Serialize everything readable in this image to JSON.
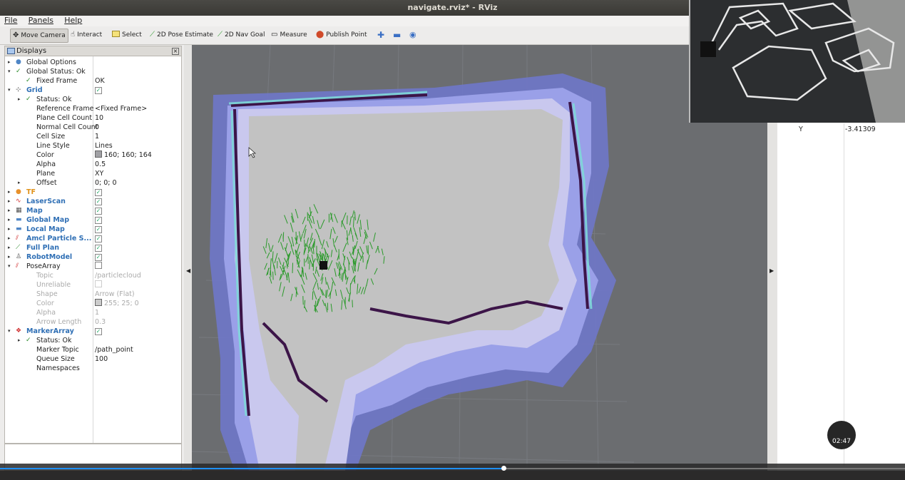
{
  "window": {
    "title": "navigate.rviz* - RViz"
  },
  "menu": [
    "File",
    "Panels",
    "Help"
  ],
  "toolbar": {
    "move_camera": "Move Camera",
    "interact": "Interact",
    "select": "Select",
    "pose_estimate": "2D Pose Estimate",
    "nav_goal": "2D Nav Goal",
    "measure": "Measure",
    "publish_point": "Publish Point"
  },
  "displays_panel": {
    "title": "Displays"
  },
  "tree": [
    {
      "name": "Global Options",
      "value": "",
      "indent": 0,
      "arrow": "▸",
      "icon": "globe-icon",
      "glyph": "●",
      "iconColor": "#4f86c6",
      "style": "",
      "check": ""
    },
    {
      "name": "Global Status: Ok",
      "value": "",
      "indent": 0,
      "arrow": "▾",
      "icon": "check-icon",
      "glyph": "✓",
      "iconColor": "#2a8a2a",
      "style": "",
      "check": ""
    },
    {
      "name": "Fixed Frame",
      "value": "OK",
      "indent": 1,
      "arrow": "",
      "icon": "check-icon",
      "glyph": "✓",
      "iconColor": "#2a8a2a",
      "style": "",
      "check": ""
    },
    {
      "name": "Grid",
      "value": "",
      "indent": 0,
      "arrow": "▾",
      "icon": "grid-icon",
      "glyph": "⊹",
      "iconColor": "#555",
      "style": "blue",
      "check": "on"
    },
    {
      "name": "Status: Ok",
      "value": "",
      "indent": 1,
      "arrow": "▸",
      "icon": "check-icon",
      "glyph": "✓",
      "iconColor": "#2a8a2a",
      "style": "",
      "check": ""
    },
    {
      "name": "Reference Frame",
      "value": "<Fixed Frame>",
      "indent": 1,
      "arrow": "",
      "icon": "",
      "glyph": "",
      "iconColor": "",
      "style": "",
      "check": ""
    },
    {
      "name": "Plane Cell Count",
      "value": "10",
      "indent": 1,
      "arrow": "",
      "icon": "",
      "glyph": "",
      "iconColor": "",
      "style": "",
      "check": ""
    },
    {
      "name": "Normal Cell Count",
      "value": "0",
      "indent": 1,
      "arrow": "",
      "icon": "",
      "glyph": "",
      "iconColor": "",
      "style": "",
      "check": ""
    },
    {
      "name": "Cell Size",
      "value": "1",
      "indent": 1,
      "arrow": "",
      "icon": "",
      "glyph": "",
      "iconColor": "",
      "style": "",
      "check": ""
    },
    {
      "name": "Line Style",
      "value": "Lines",
      "indent": 1,
      "arrow": "",
      "icon": "",
      "glyph": "",
      "iconColor": "",
      "style": "",
      "check": ""
    },
    {
      "name": "Color",
      "value": "160; 160; 164",
      "indent": 1,
      "arrow": "",
      "icon": "",
      "glyph": "",
      "iconColor": "",
      "style": "",
      "check": "",
      "swatch": "#a0a0a4"
    },
    {
      "name": "Alpha",
      "value": "0.5",
      "indent": 1,
      "arrow": "",
      "icon": "",
      "glyph": "",
      "iconColor": "",
      "style": "",
      "check": ""
    },
    {
      "name": "Plane",
      "value": "XY",
      "indent": 1,
      "arrow": "",
      "icon": "",
      "glyph": "",
      "iconColor": "",
      "style": "",
      "check": ""
    },
    {
      "name": "Offset",
      "value": "0; 0; 0",
      "indent": 1,
      "arrow": "▸",
      "icon": "",
      "glyph": "",
      "iconColor": "",
      "style": "",
      "check": ""
    },
    {
      "name": "TF",
      "value": "",
      "indent": 0,
      "arrow": "▸",
      "icon": "tf-icon",
      "glyph": "●",
      "iconColor": "#e8912b",
      "style": "orange",
      "check": "on"
    },
    {
      "name": "LaserScan",
      "value": "",
      "indent": 0,
      "arrow": "▸",
      "icon": "laser-icon",
      "glyph": "∿",
      "iconColor": "#d03030",
      "style": "blue",
      "check": "on"
    },
    {
      "name": "Map",
      "value": "",
      "indent": 0,
      "arrow": "▸",
      "icon": "map-icon",
      "glyph": "▦",
      "iconColor": "#555",
      "style": "blue",
      "check": "on"
    },
    {
      "name": "Global Map",
      "value": "",
      "indent": 0,
      "arrow": "▸",
      "icon": "folder-icon",
      "glyph": "▬",
      "iconColor": "#4f86c6",
      "style": "blue",
      "check": "on"
    },
    {
      "name": "Local Map",
      "value": "",
      "indent": 0,
      "arrow": "▸",
      "icon": "folder-icon",
      "glyph": "▬",
      "iconColor": "#4f86c6",
      "style": "blue",
      "check": "on"
    },
    {
      "name": "Amcl Particle S...",
      "value": "",
      "indent": 0,
      "arrow": "▸",
      "icon": "pose-array-icon",
      "glyph": "⫽",
      "iconColor": "#d03030",
      "style": "blue",
      "check": "on"
    },
    {
      "name": "Full Plan",
      "value": "",
      "indent": 0,
      "arrow": "▸",
      "icon": "path-icon",
      "glyph": "⟋",
      "iconColor": "#2a8a2a",
      "style": "blue",
      "check": "on"
    },
    {
      "name": "RobotModel",
      "value": "",
      "indent": 0,
      "arrow": "▸",
      "icon": "robot-icon",
      "glyph": "♙",
      "iconColor": "#555",
      "style": "blue",
      "check": "on"
    },
    {
      "name": "PoseArray",
      "value": "",
      "indent": 0,
      "arrow": "▾",
      "icon": "pose-array-icon",
      "glyph": "⫽",
      "iconColor": "#d03030",
      "style": "",
      "check": "off"
    },
    {
      "name": "Topic",
      "value": "/particlecloud",
      "indent": 1,
      "arrow": "",
      "icon": "",
      "glyph": "",
      "iconColor": "",
      "style": "grey",
      "check": ""
    },
    {
      "name": "Unreliable",
      "value": "",
      "indent": 1,
      "arrow": "",
      "icon": "",
      "glyph": "",
      "iconColor": "",
      "style": "grey",
      "check": "dim"
    },
    {
      "name": "Shape",
      "value": "Arrow (Flat)",
      "indent": 1,
      "arrow": "",
      "icon": "",
      "glyph": "",
      "iconColor": "",
      "style": "grey",
      "check": ""
    },
    {
      "name": "Color",
      "value": "255; 25; 0",
      "indent": 1,
      "arrow": "",
      "icon": "",
      "glyph": "",
      "iconColor": "",
      "style": "grey",
      "check": "",
      "swatch": "#cccccc"
    },
    {
      "name": "Alpha",
      "value": "1",
      "indent": 1,
      "arrow": "",
      "icon": "",
      "glyph": "",
      "iconColor": "",
      "style": "grey",
      "check": ""
    },
    {
      "name": "Arrow Length",
      "value": "0.3",
      "indent": 1,
      "arrow": "",
      "icon": "",
      "glyph": "",
      "iconColor": "",
      "style": "grey",
      "check": ""
    },
    {
      "name": "MarkerArray",
      "value": "",
      "indent": 0,
      "arrow": "▾",
      "icon": "marker-icon",
      "glyph": "❖",
      "iconColor": "#d03030",
      "style": "blue",
      "check": "on"
    },
    {
      "name": "Status: Ok",
      "value": "",
      "indent": 1,
      "arrow": "▸",
      "icon": "check-icon",
      "glyph": "✓",
      "iconColor": "#2a8a2a",
      "style": "",
      "check": ""
    },
    {
      "name": "Marker Topic",
      "value": "/path_point",
      "indent": 1,
      "arrow": "",
      "icon": "",
      "glyph": "",
      "iconColor": "",
      "style": "",
      "check": ""
    },
    {
      "name": "Queue Size",
      "value": "100",
      "indent": 1,
      "arrow": "",
      "icon": "",
      "glyph": "",
      "iconColor": "",
      "style": "",
      "check": ""
    },
    {
      "name": "Namespaces",
      "value": "",
      "indent": 1,
      "arrow": "",
      "icon": "",
      "glyph": "",
      "iconColor": "",
      "style": "",
      "check": ""
    }
  ],
  "right_panel": {
    "label": "Y",
    "value": "-3.41309"
  },
  "video": {
    "time": "02:47",
    "progress": 0.556
  }
}
